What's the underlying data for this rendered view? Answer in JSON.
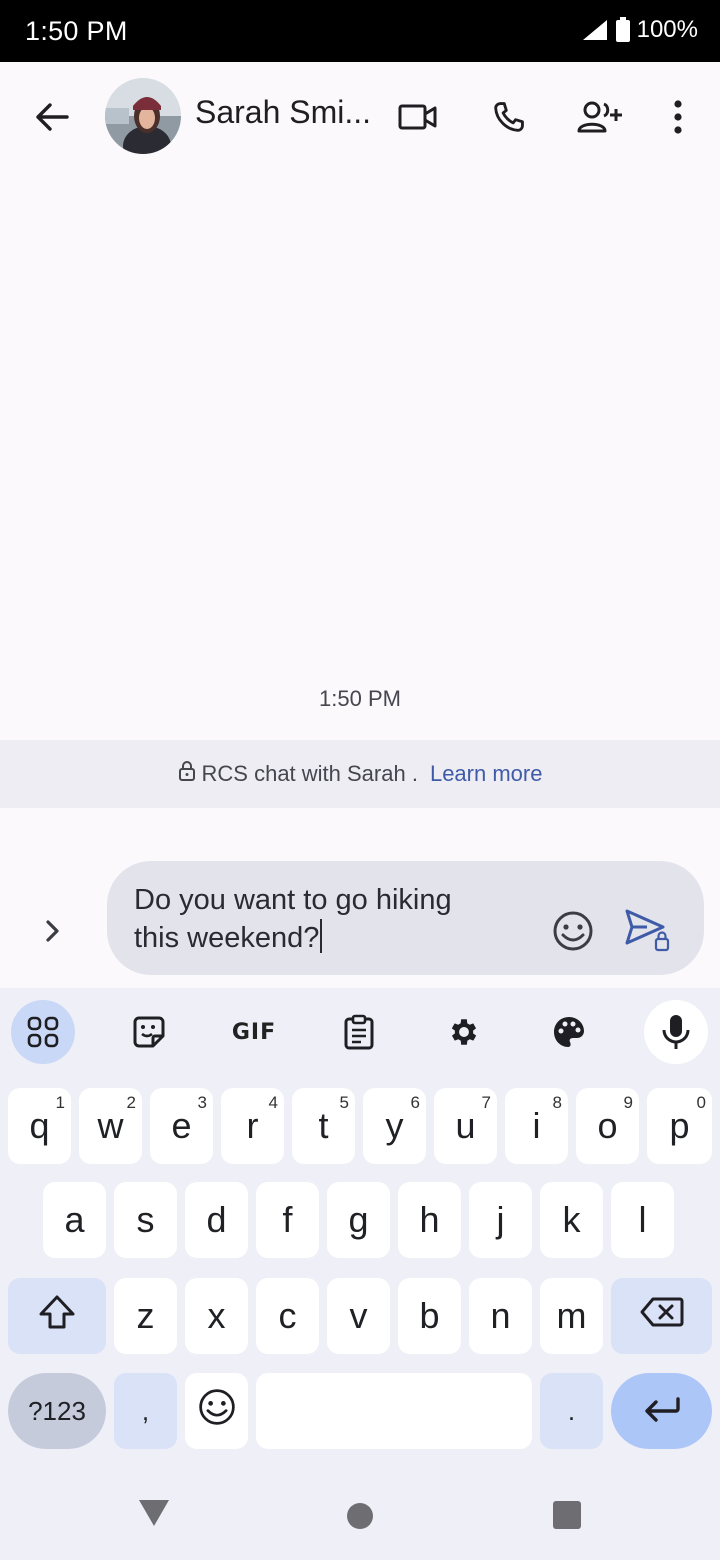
{
  "status_bar": {
    "time": "1:50 PM",
    "battery": "100%"
  },
  "header": {
    "contact_name": "Sarah Smi...",
    "back_icon": "arrow-back-icon",
    "icons": [
      "video-call-icon",
      "phone-icon",
      "add-person-icon",
      "more-vert-icon"
    ]
  },
  "conversation": {
    "timestamp": "1:50 PM"
  },
  "rcs_banner": {
    "text": "RCS chat with Sarah .",
    "link": "Learn more"
  },
  "composer": {
    "line1": "Do you want to go hiking",
    "line2": "this weekend?"
  },
  "keyboard": {
    "toolbar": {
      "gif_label": "GIF"
    },
    "row1": [
      {
        "k": "q",
        "h": "1"
      },
      {
        "k": "w",
        "h": "2"
      },
      {
        "k": "e",
        "h": "3"
      },
      {
        "k": "r",
        "h": "4"
      },
      {
        "k": "t",
        "h": "5"
      },
      {
        "k": "y",
        "h": "6"
      },
      {
        "k": "u",
        "h": "7"
      },
      {
        "k": "i",
        "h": "8"
      },
      {
        "k": "o",
        "h": "9"
      },
      {
        "k": "p",
        "h": "0"
      }
    ],
    "row2": [
      "a",
      "s",
      "d",
      "f",
      "g",
      "h",
      "j",
      "k",
      "l"
    ],
    "row3": [
      "z",
      "x",
      "c",
      "v",
      "b",
      "n",
      "m"
    ],
    "symbols_label": "?123",
    "comma": ",",
    "period": "."
  },
  "colors": {
    "accent": "#3f5aa6",
    "background": "#fcf9fd",
    "keyboard": "#eff0f7"
  }
}
